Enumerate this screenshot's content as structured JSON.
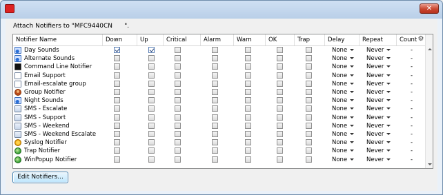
{
  "window": {
    "title": "",
    "close_glyph": "✕",
    "icon": "app-icon"
  },
  "dialog": {
    "attach_label": "Attach Notifiers to \"MFC9440CN      \".",
    "edit_button": "Edit Notifiers..."
  },
  "grid": {
    "columns": [
      "Notifier Name",
      "Down",
      "Up",
      "Critical",
      "Alarm",
      "Warn",
      "OK",
      "Trap",
      "Delay",
      "Repeat",
      "Count"
    ],
    "settings_icon": "gear-icon",
    "settings_glyph": "⚙",
    "rows": [
      {
        "name": "Day Sounds",
        "icon": "sound",
        "down": true,
        "up": true,
        "critical": false,
        "alarm": false,
        "warn": false,
        "ok": false,
        "trap": false,
        "delay": "None",
        "repeat": "Never",
        "count": "-"
      },
      {
        "name": "Alternate Sounds",
        "icon": "sound",
        "down": false,
        "up": false,
        "critical": false,
        "alarm": false,
        "warn": false,
        "ok": false,
        "trap": false,
        "delay": "None",
        "repeat": "Never",
        "count": "-"
      },
      {
        "name": "Command Line Notifier",
        "icon": "cmd",
        "down": false,
        "up": false,
        "critical": false,
        "alarm": false,
        "warn": false,
        "ok": false,
        "trap": false,
        "delay": "None",
        "repeat": "Never",
        "count": "-"
      },
      {
        "name": "Email Support",
        "icon": "email",
        "down": false,
        "up": false,
        "critical": false,
        "alarm": false,
        "warn": false,
        "ok": false,
        "trap": false,
        "delay": "None",
        "repeat": "Never",
        "count": "-"
      },
      {
        "name": "Email-escalate group",
        "icon": "email",
        "down": false,
        "up": false,
        "critical": false,
        "alarm": false,
        "warn": false,
        "ok": false,
        "trap": false,
        "delay": "None",
        "repeat": "Never",
        "count": "-"
      },
      {
        "name": "Group Notifier",
        "icon": "group",
        "down": false,
        "up": false,
        "critical": false,
        "alarm": false,
        "warn": false,
        "ok": false,
        "trap": false,
        "delay": "None",
        "repeat": "Never",
        "count": "-"
      },
      {
        "name": "Night Sounds",
        "icon": "sound",
        "down": false,
        "up": false,
        "critical": false,
        "alarm": false,
        "warn": false,
        "ok": false,
        "trap": false,
        "delay": "None",
        "repeat": "Never",
        "count": "-"
      },
      {
        "name": "SMS - Escalate",
        "icon": "sms",
        "down": false,
        "up": false,
        "critical": false,
        "alarm": false,
        "warn": false,
        "ok": false,
        "trap": false,
        "delay": "None",
        "repeat": "Never",
        "count": "-"
      },
      {
        "name": "SMS - Support",
        "icon": "sms",
        "down": false,
        "up": false,
        "critical": false,
        "alarm": false,
        "warn": false,
        "ok": false,
        "trap": false,
        "delay": "None",
        "repeat": "Never",
        "count": "-"
      },
      {
        "name": "SMS - Weekend",
        "icon": "sms",
        "down": false,
        "up": false,
        "critical": false,
        "alarm": false,
        "warn": false,
        "ok": false,
        "trap": false,
        "delay": "None",
        "repeat": "Never",
        "count": "-"
      },
      {
        "name": "SMS - Weekend Escalate",
        "icon": "sms",
        "down": false,
        "up": false,
        "critical": false,
        "alarm": false,
        "warn": false,
        "ok": false,
        "trap": false,
        "delay": "None",
        "repeat": "Never",
        "count": "-"
      },
      {
        "name": "Syslog Notifier",
        "icon": "syslog",
        "down": false,
        "up": false,
        "critical": false,
        "alarm": false,
        "warn": false,
        "ok": false,
        "trap": false,
        "delay": "None",
        "repeat": "Never",
        "count": "-"
      },
      {
        "name": "Trap Notifier",
        "icon": "globe",
        "down": false,
        "up": false,
        "critical": false,
        "alarm": false,
        "warn": false,
        "ok": false,
        "trap": false,
        "delay": "None",
        "repeat": "Never",
        "count": "-"
      },
      {
        "name": "WinPopup Notifier",
        "icon": "globe",
        "down": false,
        "up": false,
        "critical": false,
        "alarm": false,
        "warn": false,
        "ok": false,
        "trap": false,
        "delay": "None",
        "repeat": "Never",
        "count": "-"
      }
    ]
  }
}
